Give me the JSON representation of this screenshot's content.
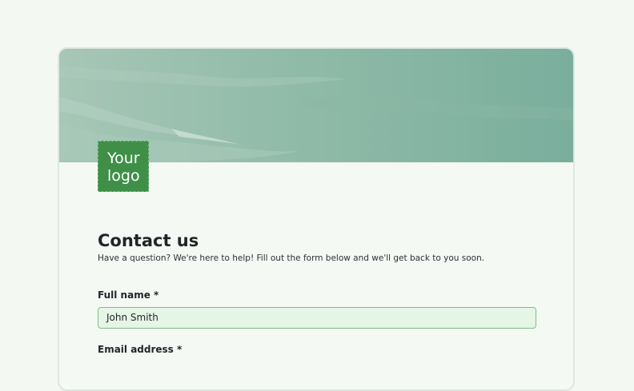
{
  "logo": {
    "text": "Your\nlogo"
  },
  "form": {
    "title": "Contact us",
    "subtitle": "Have a question? We're here to help! Fill out the form below and we'll get back to you soon.",
    "fields": [
      {
        "label": "Full name *",
        "value": "John Smith"
      },
      {
        "label": "Email address *"
      }
    ]
  },
  "colors": {
    "page_background": "#f3f8f3",
    "card_background": "#f5f9f4",
    "banner": "#8fb9a7",
    "logo_background": "#3f8f48",
    "input_background": "#e5f5e6",
    "input_border": "#7fbe86"
  }
}
